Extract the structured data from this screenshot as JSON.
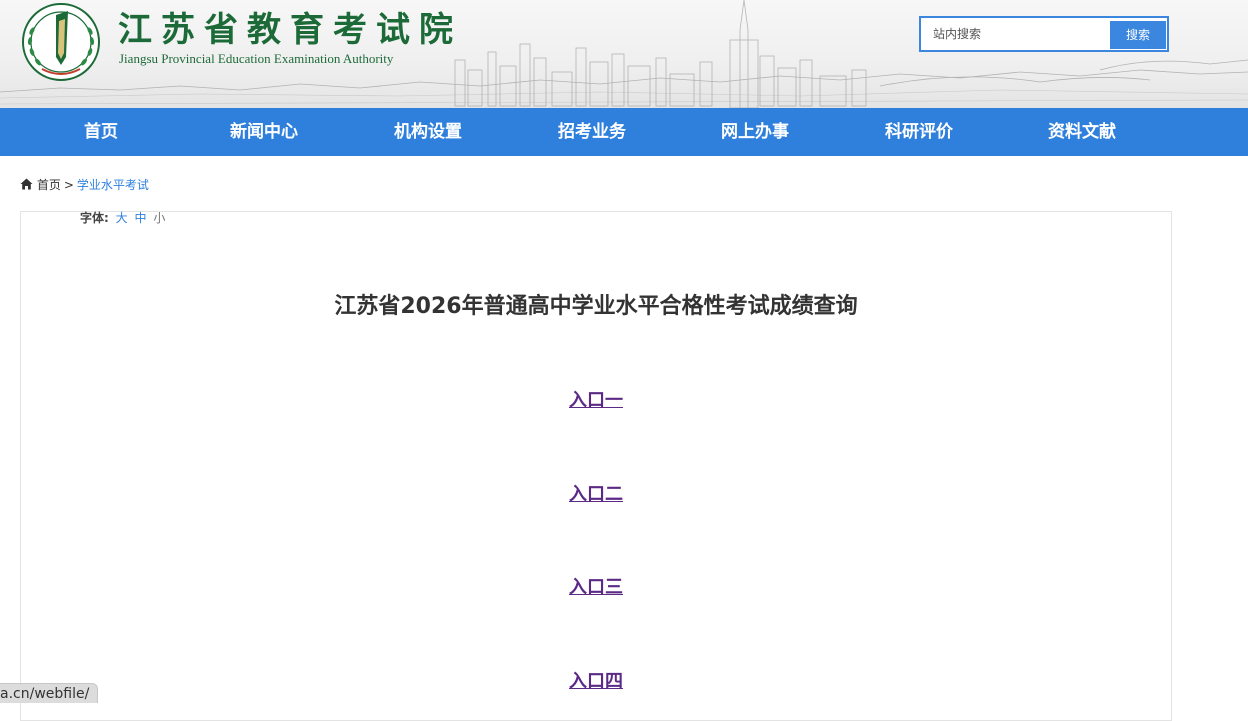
{
  "header": {
    "logo_cn": "江苏省教育考试院",
    "logo_en": "Jiangsu Provincial Education Examination Authority",
    "search_placeholder": "站内搜索",
    "search_button": "搜索"
  },
  "nav": {
    "items": [
      {
        "label": "首页"
      },
      {
        "label": "新闻中心"
      },
      {
        "label": "机构设置"
      },
      {
        "label": "招考业务"
      },
      {
        "label": "网上办事"
      },
      {
        "label": "科研评价"
      },
      {
        "label": "资料文献"
      }
    ]
  },
  "breadcrumb": {
    "home": "首页",
    "separator": ">",
    "current": "学业水平考试"
  },
  "font_size": {
    "label": "字体:",
    "large": "大",
    "medium": "中",
    "small": "小"
  },
  "content": {
    "title": "江苏省2026年普通高中学业水平合格性考试成绩查询",
    "entries": [
      "入口一",
      "入口二",
      "入口三",
      "入口四"
    ]
  },
  "status_bar": {
    "url": "a.cn/webfile/"
  },
  "colors": {
    "nav_blue": "#2f80dd",
    "logo_green": "#1c6a37",
    "link_visited": "#5b2a86"
  }
}
